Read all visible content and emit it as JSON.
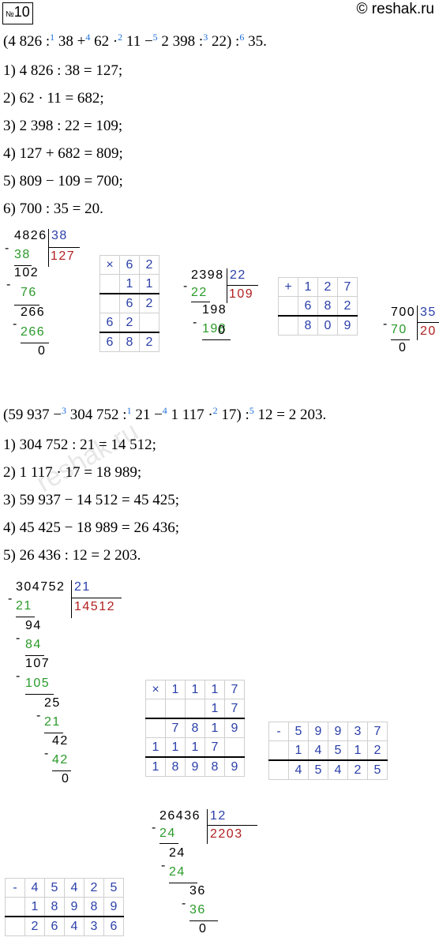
{
  "header": {
    "badge_no": "№",
    "badge_num": "10",
    "site": "© reshak.ru"
  },
  "part1": {
    "expression": [
      "(4 826 :",
      "1",
      " 38 +",
      "4",
      " 62 ·",
      "2",
      " 11 −",
      "5",
      " 2 398 :",
      "3",
      " 22) :",
      "6",
      " 35."
    ],
    "steps": [
      "1) 4 826 : 38 = 127;",
      "2) 62 · 11 = 682;",
      "3) 2 398 : 22 = 109;",
      "4) 127 + 682 = 809;",
      "5) 809 − 109 = 700;",
      "6) 700 : 35 = 20."
    ],
    "div1": {
      "dividend": "4826",
      "divisor": "38",
      "quotient": "127",
      "rows": [
        "38",
        "102",
        "76",
        "266",
        "266",
        "0"
      ]
    },
    "mul1": {
      "sign": "×",
      "rows": [
        [
          "",
          "6",
          "2"
        ],
        [
          "",
          "1",
          "1"
        ],
        [
          "",
          "6",
          "2"
        ],
        [
          "6",
          "2",
          ""
        ],
        [
          "6",
          "8",
          "2"
        ]
      ]
    },
    "div2": {
      "dividend": "2398",
      "divisor": "22",
      "quotient": "109",
      "rows": [
        "22",
        "198",
        "198",
        "0"
      ]
    },
    "add1": {
      "sign": "+",
      "rows": [
        [
          "",
          "1",
          "2",
          "7"
        ],
        [
          "",
          "6",
          "8",
          "2"
        ],
        [
          "",
          "8",
          "0",
          "9"
        ]
      ]
    },
    "div3": {
      "dividend": "700",
      "divisor": "35",
      "quotient": "20",
      "rows": [
        "70",
        "0"
      ]
    }
  },
  "part2": {
    "expression": [
      "(59 937 −",
      "3",
      " 304 752 :",
      "1",
      " 21 −",
      "4",
      " 1 117 ·",
      "2",
      " 17) :",
      "5",
      " 12 = 2 203."
    ],
    "steps": [
      "1) 304 752 : 21 = 14 512;",
      "2) 1 117 · 17 = 18 989;",
      "3) 59 937 − 14 512 = 45 425;",
      "4) 45 425 − 18 989 = 26 436;",
      "5) 26 436 : 12 = 2 203."
    ],
    "div1": {
      "dividend": "304752",
      "divisor": "21",
      "quotient": "14512",
      "rows": [
        "21",
        "94",
        "84",
        "107",
        "105",
        "25",
        "21",
        "42",
        "42",
        "0"
      ]
    },
    "mul1": {
      "sign": "×",
      "rows": [
        [
          "",
          "1",
          "1",
          "1",
          "7"
        ],
        [
          "",
          "",
          "",
          "1",
          "7"
        ],
        [
          "",
          "7",
          "8",
          "1",
          "9"
        ],
        [
          "1",
          "1",
          "1",
          "7",
          ""
        ],
        [
          "1",
          "8",
          "9",
          "8",
          "9"
        ]
      ]
    },
    "sub1": {
      "sign": "-",
      "rows": [
        [
          "",
          "5",
          "9",
          "9",
          "3",
          "7"
        ],
        [
          "",
          "1",
          "4",
          "5",
          "1",
          "2"
        ],
        [
          "",
          "4",
          "5",
          "4",
          "2",
          "5"
        ]
      ]
    },
    "div2": {
      "dividend": "26436",
      "divisor": "12",
      "quotient": "2203",
      "rows": [
        "24",
        "24",
        "24",
        "36",
        "36",
        "0"
      ]
    },
    "sub2": {
      "sign": "-",
      "rows": [
        [
          "",
          "4",
          "5",
          "4",
          "2",
          "5"
        ],
        [
          "",
          "1",
          "8",
          "9",
          "8",
          "9"
        ],
        [
          "",
          "2",
          "6",
          "4",
          "3",
          "6"
        ]
      ]
    }
  },
  "watermark": "reshak.ru"
}
